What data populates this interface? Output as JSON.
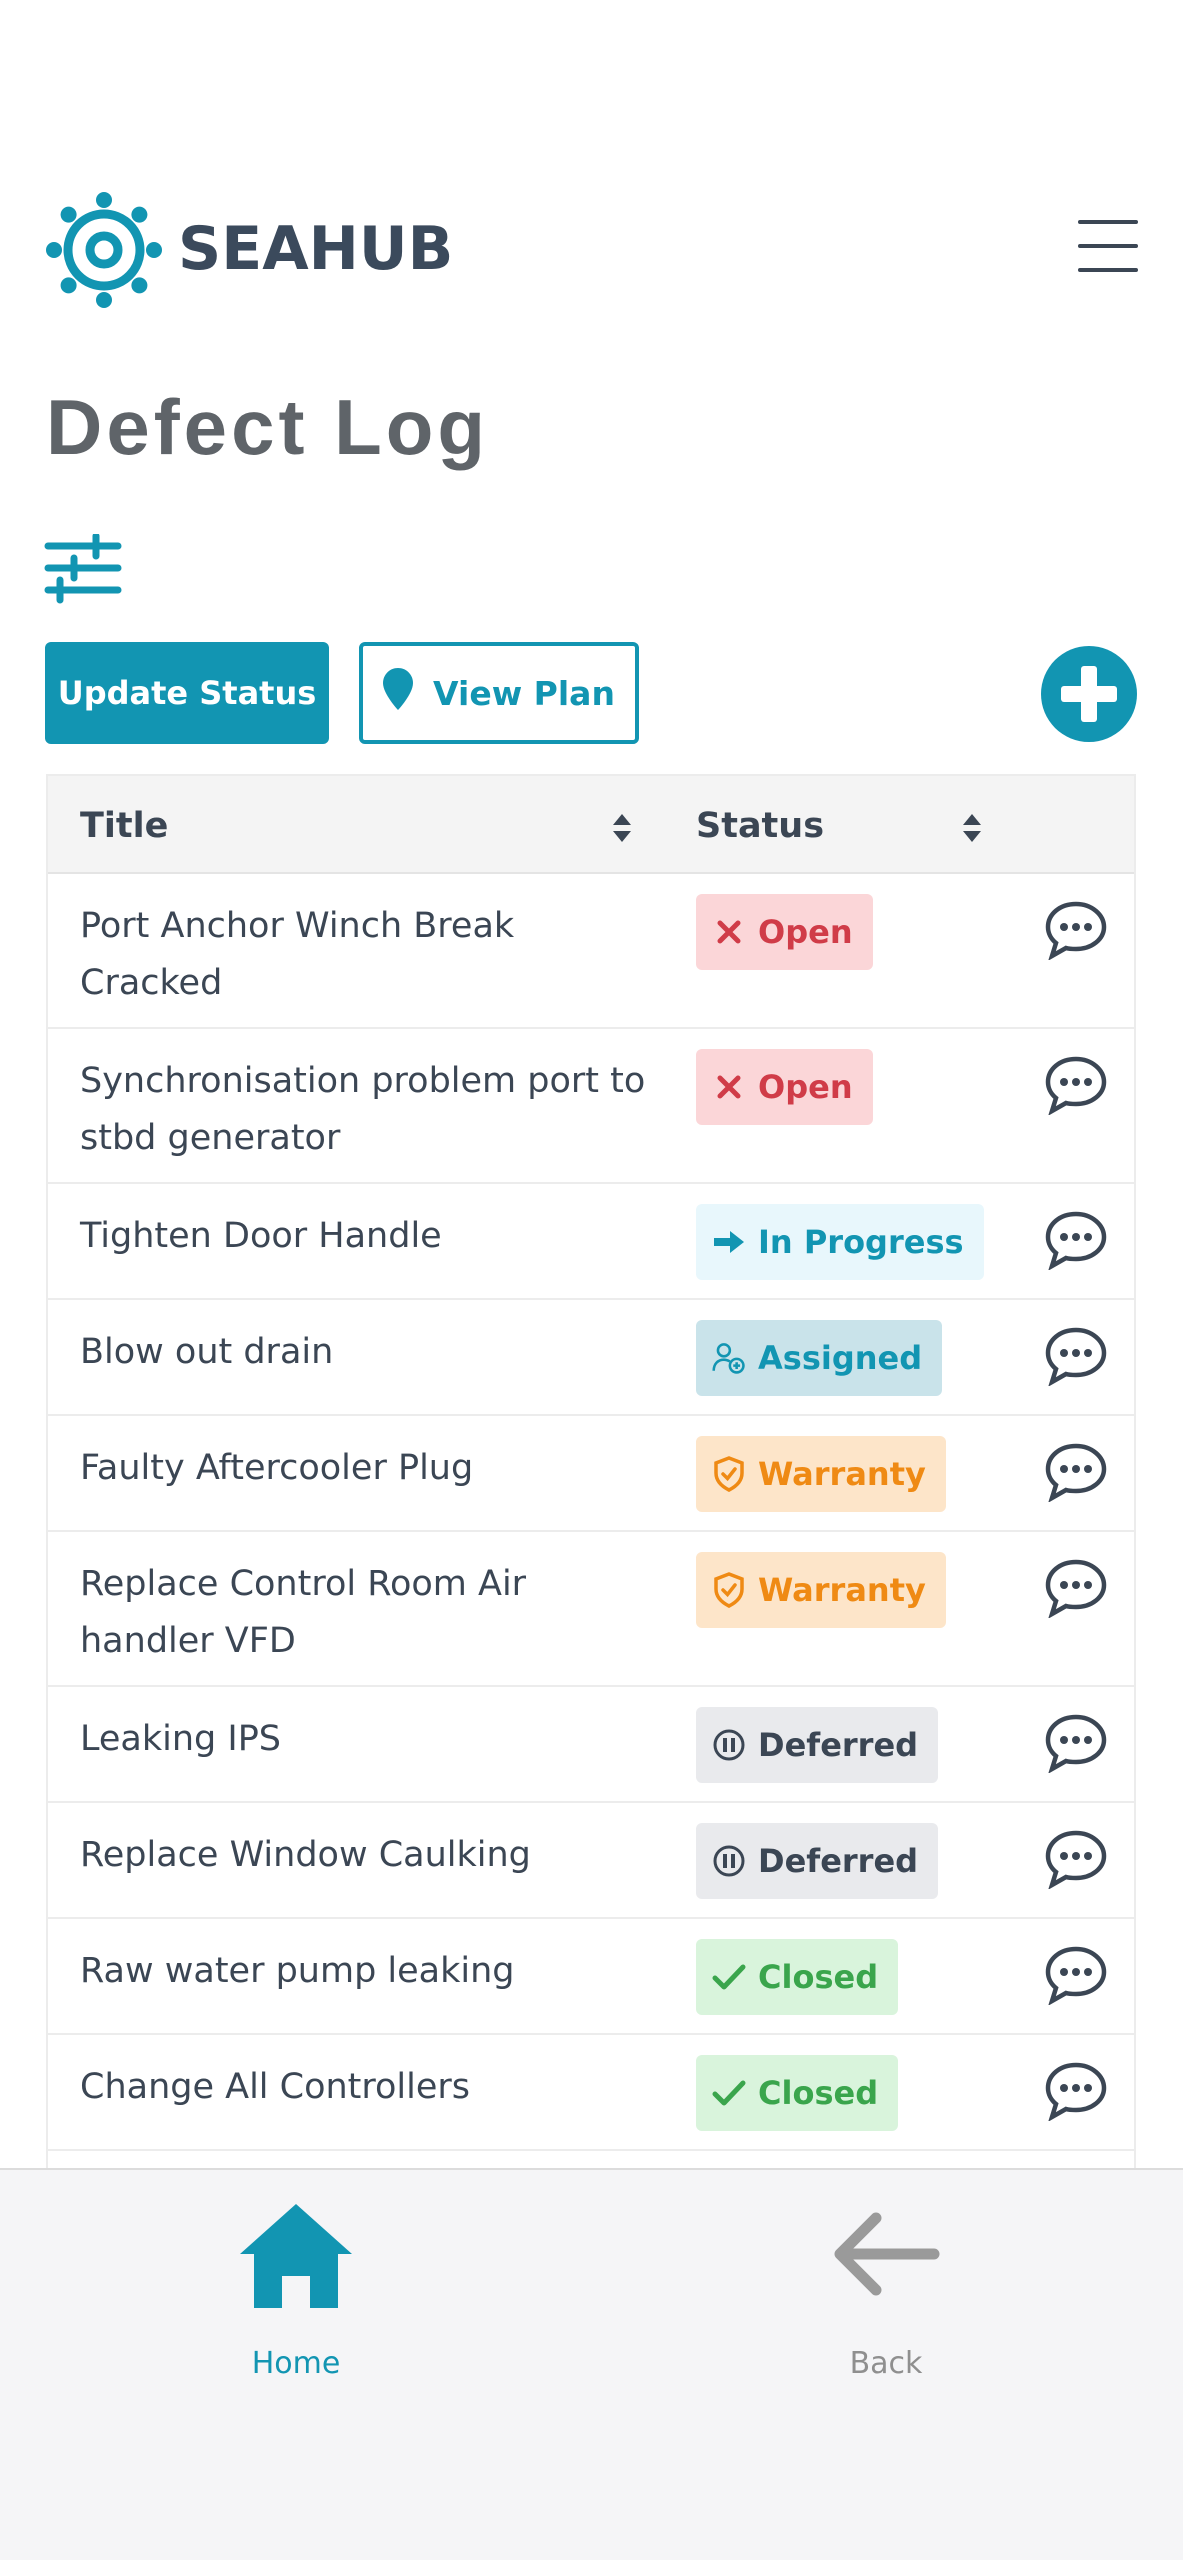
{
  "app": {
    "brand": "SEAHUB",
    "accent": "#1295b2"
  },
  "page": {
    "title": "Defect Log"
  },
  "toolbar": {
    "update_label": "Update Status",
    "plan_label": "View Plan"
  },
  "table": {
    "columns": [
      "Title",
      "Status"
    ],
    "rows": [
      {
        "title": "Port Anchor Winch Break Cracked",
        "status": "Open",
        "icon": "x-icon"
      },
      {
        "title": "Synchronisation problem port to stbd generator",
        "status": "Open",
        "icon": "x-icon"
      },
      {
        "title": "Tighten Door Handle",
        "status": "In Progress",
        "icon": "arrow-right-icon"
      },
      {
        "title": "Blow out drain",
        "status": "Assigned",
        "icon": "user-add-icon"
      },
      {
        "title": "Faulty Aftercooler Plug",
        "status": "Warranty",
        "icon": "shield-check-icon"
      },
      {
        "title": "Replace Control Room Air handler VFD",
        "status": "Warranty",
        "icon": "shield-check-icon"
      },
      {
        "title": "Leaking IPS",
        "status": "Deferred",
        "icon": "pause-circle-icon"
      },
      {
        "title": "Replace Window Caulking",
        "status": "Deferred",
        "icon": "pause-circle-icon"
      },
      {
        "title": "Raw water pump leaking",
        "status": "Closed",
        "icon": "check-icon"
      },
      {
        "title": "Change All Controllers",
        "status": "Closed",
        "icon": "check-icon"
      }
    ]
  },
  "nav": {
    "home_label": "Home",
    "back_label": "Back"
  }
}
